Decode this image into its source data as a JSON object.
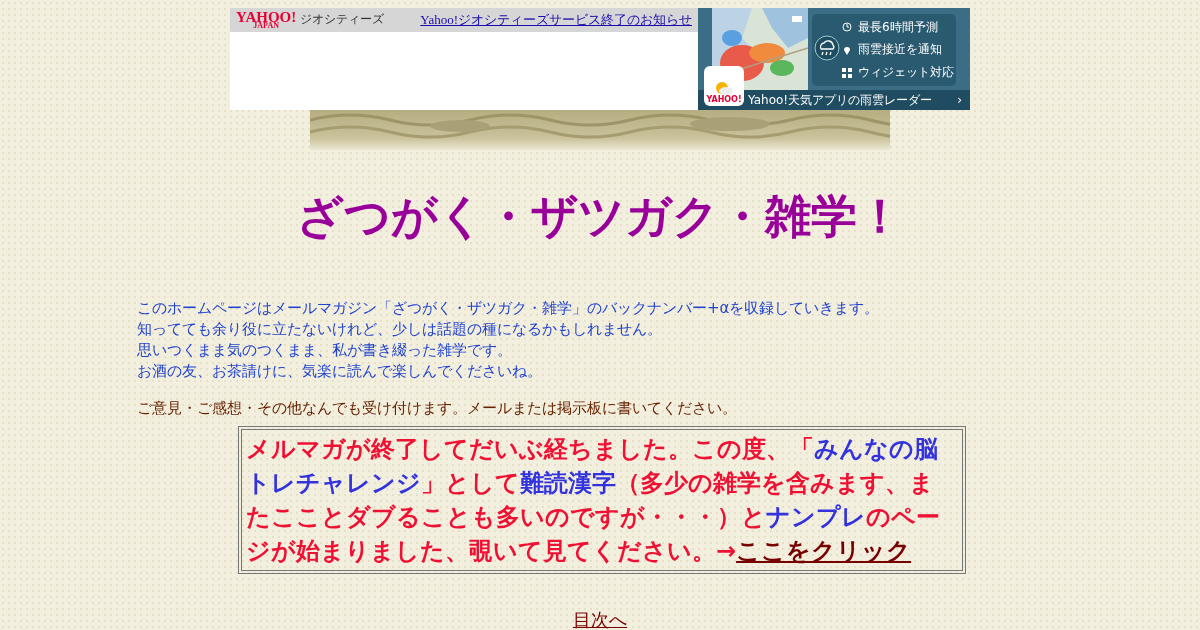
{
  "banner": {
    "logo": "YAHOO!",
    "logo_sub": "JAPAN",
    "service": "ジオシティーズ",
    "notice_link": "Yahoo!ジオシティーズサービス終了のお知らせ"
  },
  "ad": {
    "features": [
      "最長6時間予測",
      "雨雲接近を通知",
      "ウィジェット対応"
    ],
    "app_label": "YAHOO!",
    "footer": "Yahoo!天気アプリの雨雲レーダー",
    "chevron": "›"
  },
  "title": "ざつがく・ザツガク・雑学！",
  "intro": [
    "このホームページはメールマガジン「ざつがく・ザツガク・雑学」のバックナンバー+αを収録していきます。",
    "知ってても余り役に立たないけれど、少しは話題の種になるかもしれません。",
    "思いつくまま気のつくまま、私が書き綴った雑学です。",
    "お酒の友、お茶請けに、気楽に読んで楽しんでくださいね。"
  ],
  "feedback": "ご意見・ご感想・その他なんでも受け付けます。メールまたは掲示板に書いてください。",
  "notice": {
    "segments": [
      {
        "text": "メルマガが終了してだいぶ経ちました。この度、「",
        "color": "#ee1133"
      },
      {
        "text": "みんなの脳トレチャレンジ",
        "color": "#3333dd"
      },
      {
        "text": "」として",
        "color": "#ee1133"
      },
      {
        "text": "難読漢字",
        "color": "#3333dd"
      },
      {
        "text": "（多少の雑学を含みます、またこことダブることも多いのですが・・・）と",
        "color": "#ee1133"
      },
      {
        "text": "ナンプレ",
        "color": "#3333dd"
      },
      {
        "text": "のページが始まりました、覗いて見てください。→",
        "color": "#ee1133"
      }
    ],
    "link": "ここをクリック"
  },
  "footer_link": "目次へ"
}
